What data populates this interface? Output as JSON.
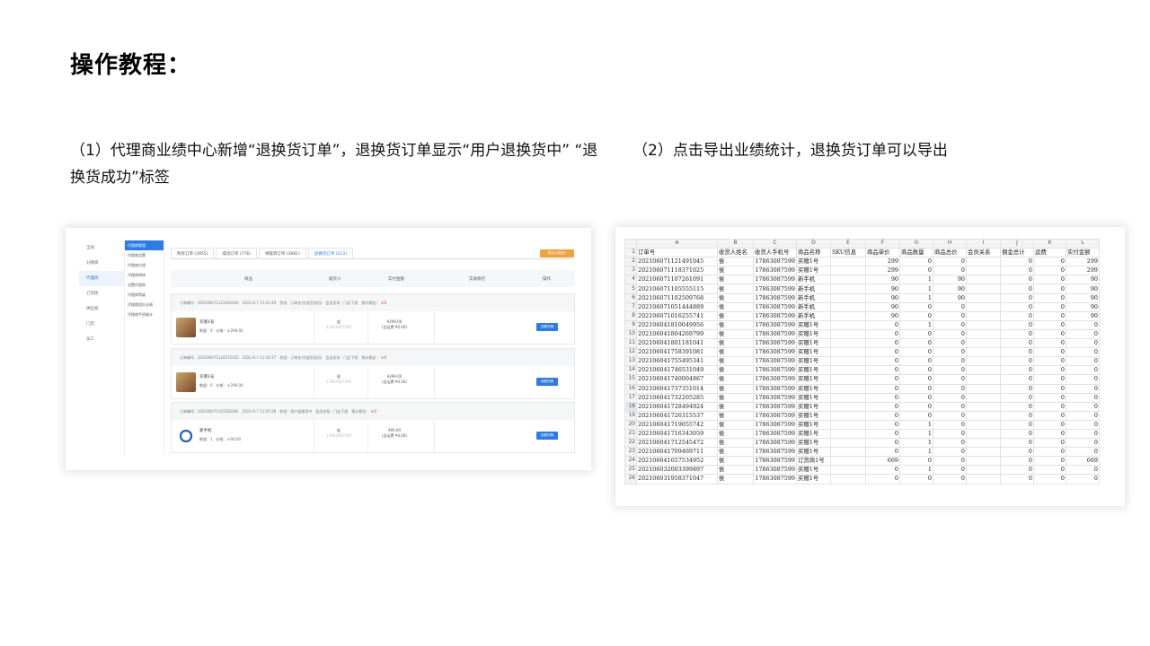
{
  "title": "操作教程：",
  "captions": {
    "left": "（1）代理商业绩中心新增“退换货订单”，退换货订单显示“用户退换货中” “退换货成功”标签",
    "right": "（2）点击导出业绩统计，退换货订单可以导出"
  },
  "admin_screenshot": {
    "menu": [
      "全局",
      "分销商",
      "代理商",
      "订货商",
      "供应商",
      "门店",
      "员工"
    ],
    "submenu": [
      "代理商管理",
      "代理商设置",
      "代理商分组",
      "代理商审核",
      "设置代理商",
      "代理商等级",
      "代理商团队业绩",
      "代理商手机统计"
    ],
    "tabs": [
      "所有订单 (3955)",
      "成功订单 (776)",
      "待取消订单 (3081)",
      "退换货订单 (213)"
    ],
    "export_button": "导出业绩统计",
    "table_headers": [
      "商品",
      "收货人",
      "实付金额",
      "实收款店",
      "操作"
    ],
    "orders": [
      {
        "header": "订单编号：202106071121491045　2021-6-7 11:21:49　状态：订单支付(退货成功)　会员关系：门店下线　预计佣金：",
        "commission": "￥0",
        "product": "买赠1号",
        "meta": "数量：0　价格：￥299.00",
        "receiver": "侯",
        "phone": "17863087599",
        "pay": "¥299.00",
        "pay_note": "(含运费 ¥0.00)",
        "action": "查看详情"
      },
      {
        "header": "订单编号：202106071118371025　2021-6-7 11:18:37　状态：订单支付(退货成功)　会员关系：门店下线　预计佣金：",
        "commission": "￥0",
        "product": "买赠1号",
        "meta": "数量：0　价格：￥299.00",
        "receiver": "侯",
        "phone": "17863087599",
        "pay": "¥299.00",
        "pay_note": "(含运费 ¥0.00)",
        "action": "查看详情"
      },
      {
        "header": "订单编号：202106071107261091　2021-6-7 11:07:26　状态：用户退换货中　会员关系：门店下线　预计佣金：",
        "commission": "￥0",
        "product": "新手机",
        "meta": "数量：1　价格：￥90.00",
        "receiver": "侯",
        "phone": "17863087599",
        "pay": "¥90.00",
        "pay_note": "(含运费 ¥0.00)",
        "action": "查看详情",
        "blue": true
      }
    ]
  },
  "spreadsheet": {
    "columns": [
      "A",
      "B",
      "C",
      "D",
      "E",
      "F",
      "G",
      "H",
      "I",
      "J",
      "K",
      "L"
    ],
    "selected_row": 18,
    "rows": [
      [
        "订单号",
        "收货人姓名",
        "收货人手机号",
        "商品名称",
        "SKU信息",
        "商品单价",
        "商品数量",
        "商品总价",
        "会员关系",
        "佣金总计",
        "运费",
        "实付金额"
      ],
      [
        "202106071121491045",
        "侯",
        "17863087599",
        "买赠1号",
        "",
        "299",
        "0",
        "0",
        "",
        "0",
        "0",
        "299"
      ],
      [
        "202106071118371025",
        "侯",
        "17863087599",
        "买赠1号",
        "",
        "299",
        "0",
        "0",
        "",
        "0",
        "0",
        "299"
      ],
      [
        "202106071107261091",
        "侯",
        "17863087599",
        "新手机",
        "",
        "90",
        "1",
        "90",
        "",
        "0",
        "0",
        "90"
      ],
      [
        "202106071105555115",
        "侯",
        "17863087599",
        "新手机",
        "",
        "90",
        "1",
        "90",
        "",
        "0",
        "0",
        "90"
      ],
      [
        "202106071102509768",
        "侯",
        "17863087599",
        "新手机",
        "",
        "90",
        "1",
        "90",
        "",
        "0",
        "0",
        "90"
      ],
      [
        "202106071051444889",
        "侯",
        "17863087599",
        "新手机",
        "",
        "90",
        "0",
        "0",
        "",
        "0",
        "0",
        "90"
      ],
      [
        "202106071016255741",
        "侯",
        "17863087599",
        "新手机",
        "",
        "90",
        "0",
        "0",
        "",
        "0",
        "0",
        "90"
      ],
      [
        "202106041810049956",
        "侯",
        "17863087599",
        "买赠1号",
        "",
        "0",
        "1",
        "0",
        "",
        "0",
        "0",
        "0"
      ],
      [
        "202106041804269799",
        "侯",
        "17863087599",
        "买赠1号",
        "",
        "0",
        "0",
        "0",
        "",
        "0",
        "0",
        "0"
      ],
      [
        "202106041801181041",
        "侯",
        "17863087599",
        "买赠1号",
        "",
        "0",
        "0",
        "0",
        "",
        "0",
        "0",
        "0"
      ],
      [
        "202106041758391081",
        "侯",
        "17863087599",
        "买赠1号",
        "",
        "0",
        "0",
        "0",
        "",
        "0",
        "0",
        "0"
      ],
      [
        "202106041755495341",
        "侯",
        "17863087599",
        "买赠1号",
        "",
        "0",
        "0",
        "0",
        "",
        "0",
        "0",
        "0"
      ],
      [
        "202106041746531049",
        "侯",
        "17863087599",
        "买赠1号",
        "",
        "0",
        "0",
        "0",
        "",
        "0",
        "0",
        "0"
      ],
      [
        "202106041740004867",
        "侯",
        "17863087599",
        "买赠1号",
        "",
        "0",
        "0",
        "0",
        "",
        "0",
        "0",
        "0"
      ],
      [
        "202106041737351014",
        "侯",
        "17863087599",
        "买赠1号",
        "",
        "0",
        "0",
        "0",
        "",
        "0",
        "0",
        "0"
      ],
      [
        "202106041732205285",
        "侯",
        "17863087599",
        "买赠1号",
        "",
        "0",
        "0",
        "0",
        "",
        "0",
        "0",
        "0"
      ],
      [
        "202106041728494924",
        "侯",
        "17863087599",
        "买赠1号",
        "",
        "0",
        "0",
        "0",
        "",
        "0",
        "0",
        "0"
      ],
      [
        "202106041726315537",
        "侯",
        "17863087599",
        "买赠1号",
        "",
        "0",
        "0",
        "0",
        "",
        "0",
        "0",
        "0"
      ],
      [
        "202106041719055742",
        "侯",
        "17863087599",
        "买赠1号",
        "",
        "0",
        "1",
        "0",
        "",
        "0",
        "0",
        "0"
      ],
      [
        "202106041716343059",
        "侯",
        "17863087599",
        "买赠1号",
        "",
        "0",
        "1",
        "0",
        "",
        "0",
        "0",
        "0"
      ],
      [
        "202106041712545472",
        "侯",
        "17863087599",
        "买赠1号",
        "",
        "0",
        "1",
        "0",
        "",
        "0",
        "0",
        "0"
      ],
      [
        "202106041709469711",
        "侯",
        "17863087599",
        "买赠1号",
        "",
        "0",
        "1",
        "0",
        "",
        "0",
        "0",
        "0"
      ],
      [
        "202106041657534952",
        "侯",
        "17863087599",
        "订货商1号",
        "",
        "669",
        "0",
        "0",
        "",
        "0",
        "0",
        "669"
      ],
      [
        "202106032003399897",
        "侯",
        "17863087599",
        "买赠1号",
        "",
        "0",
        "1",
        "0",
        "",
        "0",
        "0",
        "0"
      ],
      [
        "202106031958371047",
        "侯",
        "17863087599",
        "买赠1号",
        "",
        "0",
        "0",
        "0",
        "",
        "0",
        "0",
        "0"
      ]
    ]
  }
}
